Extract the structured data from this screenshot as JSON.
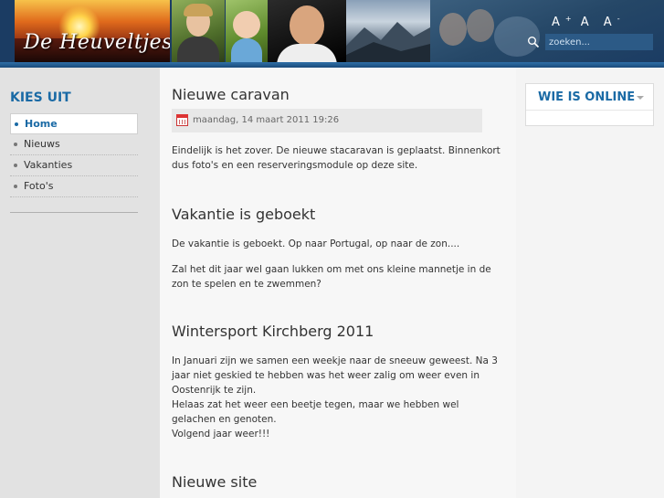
{
  "header": {
    "logo_text": "De Heuveltjes",
    "font_sizes": [
      "A",
      "A",
      "A"
    ],
    "font_marks": [
      "+",
      "",
      "-"
    ],
    "search_placeholder": "zoeken..."
  },
  "sidebar": {
    "title": "KIES UIT",
    "items": [
      {
        "label": "Home",
        "active": true
      },
      {
        "label": "Nieuws",
        "active": false
      },
      {
        "label": "Vakanties",
        "active": false
      },
      {
        "label": "Foto's",
        "active": false
      }
    ]
  },
  "articles": [
    {
      "title": "Nieuwe caravan",
      "date": "maandag, 14 maart 2011 19:26",
      "paragraphs": [
        "Eindelijk is het zover. De nieuwe stacaravan is geplaatst. Binnenkort dus foto's en een reserveringsmodule op deze site."
      ]
    },
    {
      "title": "Vakantie is geboekt",
      "paragraphs": [
        "De vakantie is geboekt. Op naar Portugal, op naar de zon....",
        "Zal het dit jaar wel gaan lukken om met ons kleine mannetje in de zon te spelen en te zwemmen?"
      ]
    },
    {
      "title": "Wintersport Kirchberg 2011",
      "paragraphs": [
        "In Januari zijn we samen een weekje naar de sneeuw geweest. Na 3 jaar niet geskied te hebben was het weer zalig om weer even in Oostenrijk te zijn.",
        "Helaas zat het weer een beetje tegen, maar we hebben wel gelachen en genoten.",
        "Volgend jaar weer!!!"
      ]
    },
    {
      "title": "Nieuwe site",
      "paragraphs": []
    }
  ],
  "right": {
    "module_title": "WIE IS ONLINE"
  },
  "colors": {
    "accent": "#1a6aa5",
    "header_bg": "#1b3c63"
  }
}
